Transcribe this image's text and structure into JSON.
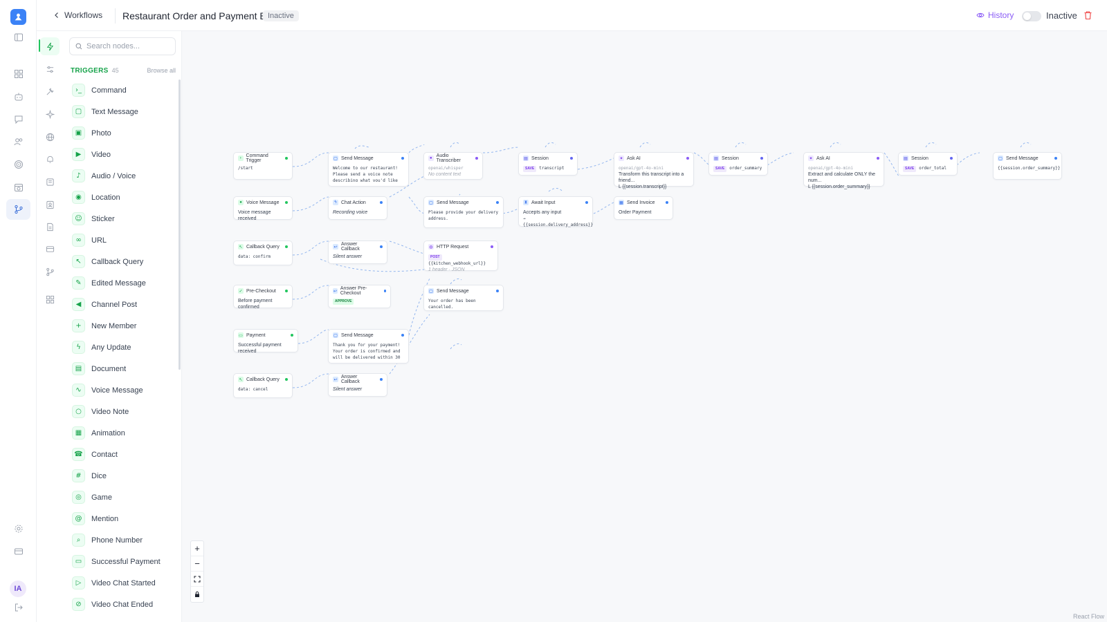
{
  "header": {
    "back_label": "Workflows",
    "title": "Restaurant Order and Payment Bot",
    "status_badge": "Inactive",
    "history_label": "History",
    "toggle_label": "Inactive"
  },
  "user": {
    "initials": "IA"
  },
  "palette": {
    "search_placeholder": "Search nodes...",
    "section_title": "TRIGGERS",
    "section_count": "45",
    "browse_all": "Browse all",
    "triggers": [
      {
        "label": "Command",
        "icon": "terminal-icon"
      },
      {
        "label": "Text Message",
        "icon": "message-icon"
      },
      {
        "label": "Photo",
        "icon": "image-icon"
      },
      {
        "label": "Video",
        "icon": "video-icon"
      },
      {
        "label": "Audio / Voice",
        "icon": "mic-icon"
      },
      {
        "label": "Location",
        "icon": "map-pin-icon"
      },
      {
        "label": "Sticker",
        "icon": "smile-icon"
      },
      {
        "label": "URL",
        "icon": "link-icon"
      },
      {
        "label": "Callback Query",
        "icon": "pointer-icon"
      },
      {
        "label": "Edited Message",
        "icon": "pencil-icon"
      },
      {
        "label": "Channel Post",
        "icon": "megaphone-icon"
      },
      {
        "label": "New Member",
        "icon": "user-plus-icon"
      },
      {
        "label": "Any Update",
        "icon": "zap-icon"
      },
      {
        "label": "Document",
        "icon": "file-icon"
      },
      {
        "label": "Voice Message",
        "icon": "voice-icon"
      },
      {
        "label": "Video Note",
        "icon": "circle-icon"
      },
      {
        "label": "Animation",
        "icon": "film-icon"
      },
      {
        "label": "Contact",
        "icon": "phone-icon"
      },
      {
        "label": "Dice",
        "icon": "hash-icon"
      },
      {
        "label": "Game",
        "icon": "gamepad-icon"
      },
      {
        "label": "Mention",
        "icon": "at-icon"
      },
      {
        "label": "Phone Number",
        "icon": "search-phone-icon"
      },
      {
        "label": "Successful Payment",
        "icon": "card-icon"
      },
      {
        "label": "Video Chat Started",
        "icon": "video-start-icon"
      },
      {
        "label": "Video Chat Ended",
        "icon": "video-off-icon"
      }
    ]
  },
  "nodes": {
    "cmd_trigger": {
      "title": "Command Trigger",
      "body": "/start"
    },
    "send1": {
      "title": "Send Message",
      "body": "Welcome to our restaurant! Please send a voice note describing what you'd like to"
    },
    "audio": {
      "title": "Audio Transcriber",
      "model": "openai/whisper",
      "note": "No content text"
    },
    "session1": {
      "title": "Session",
      "tag": "SAVE",
      "value": "transcript"
    },
    "askai1": {
      "title": "Ask AI",
      "model": "openai/gpt-4o-mini",
      "prompt": "Transform this transcript into a friend...",
      "ref": "L {{session.transcript}}"
    },
    "session2": {
      "title": "Session",
      "tag": "SAVE",
      "value": "order_summary"
    },
    "askai2": {
      "title": "Ask AI",
      "model": "openai/gpt-4o-mini",
      "prompt": "Extract and calculate ONLY the num...",
      "ref": "L {{session.order_summary}}"
    },
    "session3": {
      "title": "Session",
      "tag": "SAVE",
      "value": "order_total"
    },
    "send_final": {
      "title": "Send Message",
      "body": "{{session.order_summary}}"
    },
    "voice": {
      "title": "Voice Message",
      "body": "Voice message received"
    },
    "chat_action": {
      "title": "Chat Action",
      "body": "Recording voice"
    },
    "send2": {
      "title": "Send Message",
      "body": "Please provide your delivery address."
    },
    "await": {
      "title": "Await Input",
      "body": "Accepts any input",
      "ref": "→ {{session.delivery_address}}"
    },
    "invoice": {
      "title": "Send Invoice",
      "body": "Order Payment"
    },
    "cb1": {
      "title": "Callback Query",
      "body": "data: confirm"
    },
    "ans_cb1": {
      "title": "Answer Callback",
      "body": "Silent answer"
    },
    "http": {
      "title": "HTTP Request",
      "tag": "POST",
      "url": "{{kitchen_webhook_url}}",
      "sub": "1 header · JSON"
    },
    "pre_checkout": {
      "title": "Pre-Checkout",
      "body": "Before payment confirmed"
    },
    "ans_pre": {
      "title": "Answer Pre-Checkout",
      "tag": "APPROVE"
    },
    "send3": {
      "title": "Send Message",
      "body": "Your order has been cancelled."
    },
    "payment": {
      "title": "Payment",
      "body": "Successful payment received"
    },
    "send4": {
      "title": "Send Message",
      "body": "Thank you for your payment! Your order is confirmed and will be delivered within 30"
    },
    "cb2": {
      "title": "Callback Query",
      "body": "data: cancel"
    },
    "ans_cb2": {
      "title": "Answer Callback",
      "body": "Silent answer"
    }
  },
  "canvas": {
    "attribution": "React Flow"
  },
  "colors": {
    "accent": "#3b82f6",
    "trigger_green": "#16a34a",
    "history_purple": "#8b5cf6",
    "delete_red": "#ef4444"
  }
}
